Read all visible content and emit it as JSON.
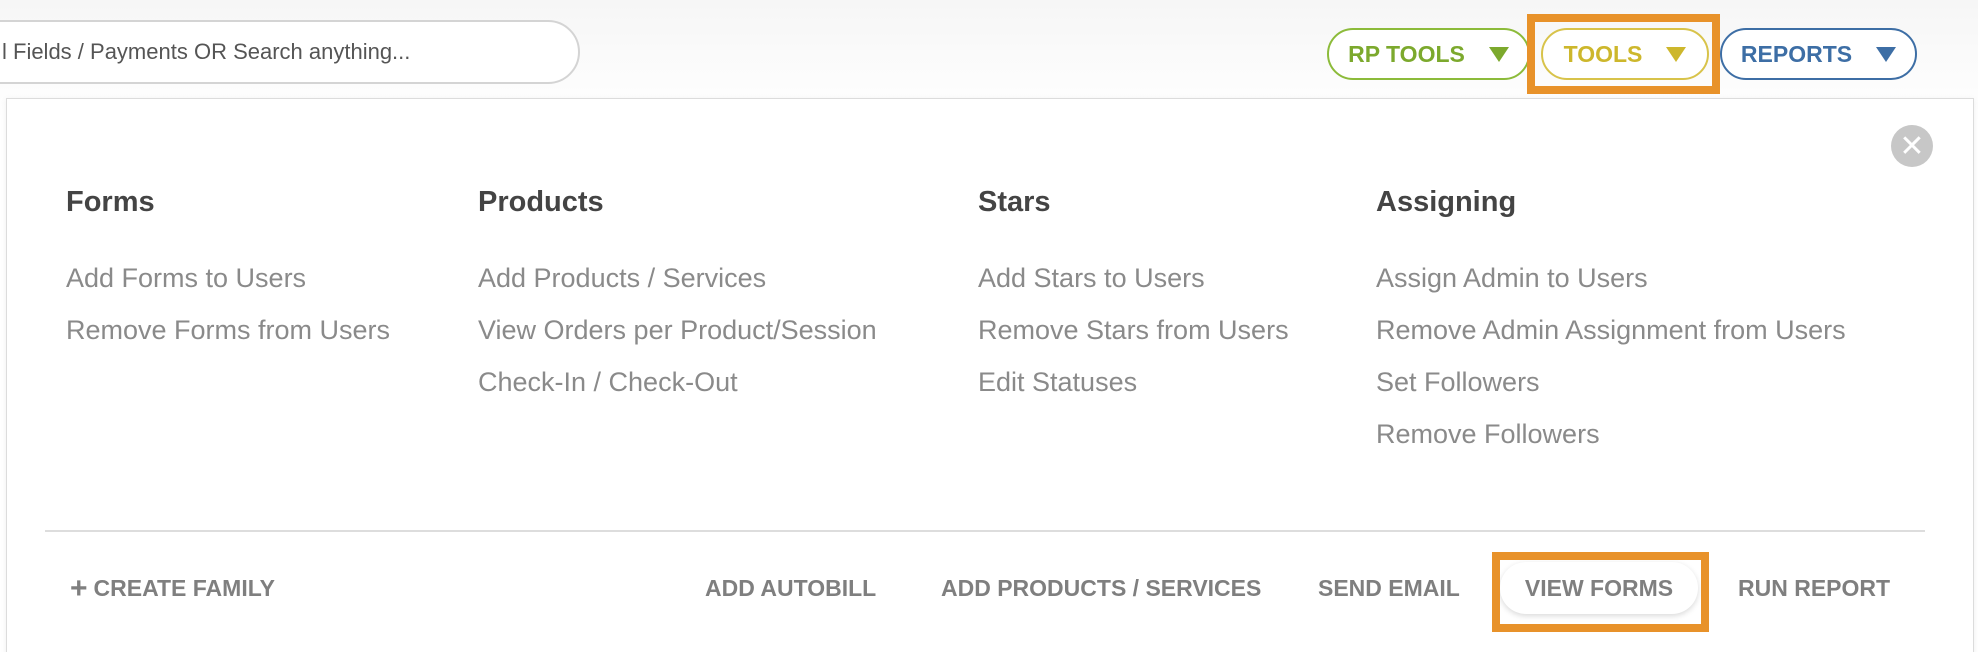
{
  "search": {
    "placeholder": "l Fields / Payments OR Search anything..."
  },
  "header": {
    "rp_tools_label": "RP TOOLS",
    "tools_label": "TOOLS",
    "reports_label": "REPORTS"
  },
  "colors": {
    "rp_tools": "#7ca92d",
    "tools": "#cdb72c",
    "reports": "#3d6ea5",
    "highlight": "#e8922a"
  },
  "menu": {
    "close_glyph": "✕",
    "columns": [
      {
        "title": "Forms",
        "items": [
          "Add Forms to Users",
          "Remove Forms from Users"
        ]
      },
      {
        "title": "Products",
        "items": [
          "Add Products / Services",
          "View Orders per Product/Session",
          "Check-In / Check-Out"
        ]
      },
      {
        "title": "Stars",
        "items": [
          "Add Stars to Users",
          "Remove Stars from Users",
          "Edit Statuses"
        ]
      },
      {
        "title": "Assigning",
        "items": [
          "Assign Admin to Users",
          "Remove Admin Assignment from Users",
          "Set Followers",
          "Remove Followers"
        ]
      }
    ]
  },
  "actions": {
    "plus_glyph": "+",
    "create_family": "CREATE FAMILY",
    "add_autobill": "ADD AUTOBILL",
    "add_products_services": "ADD PRODUCTS / SERVICES",
    "send_email": "SEND EMAIL",
    "view_forms": "VIEW FORMS",
    "run_report": "RUN REPORT"
  }
}
